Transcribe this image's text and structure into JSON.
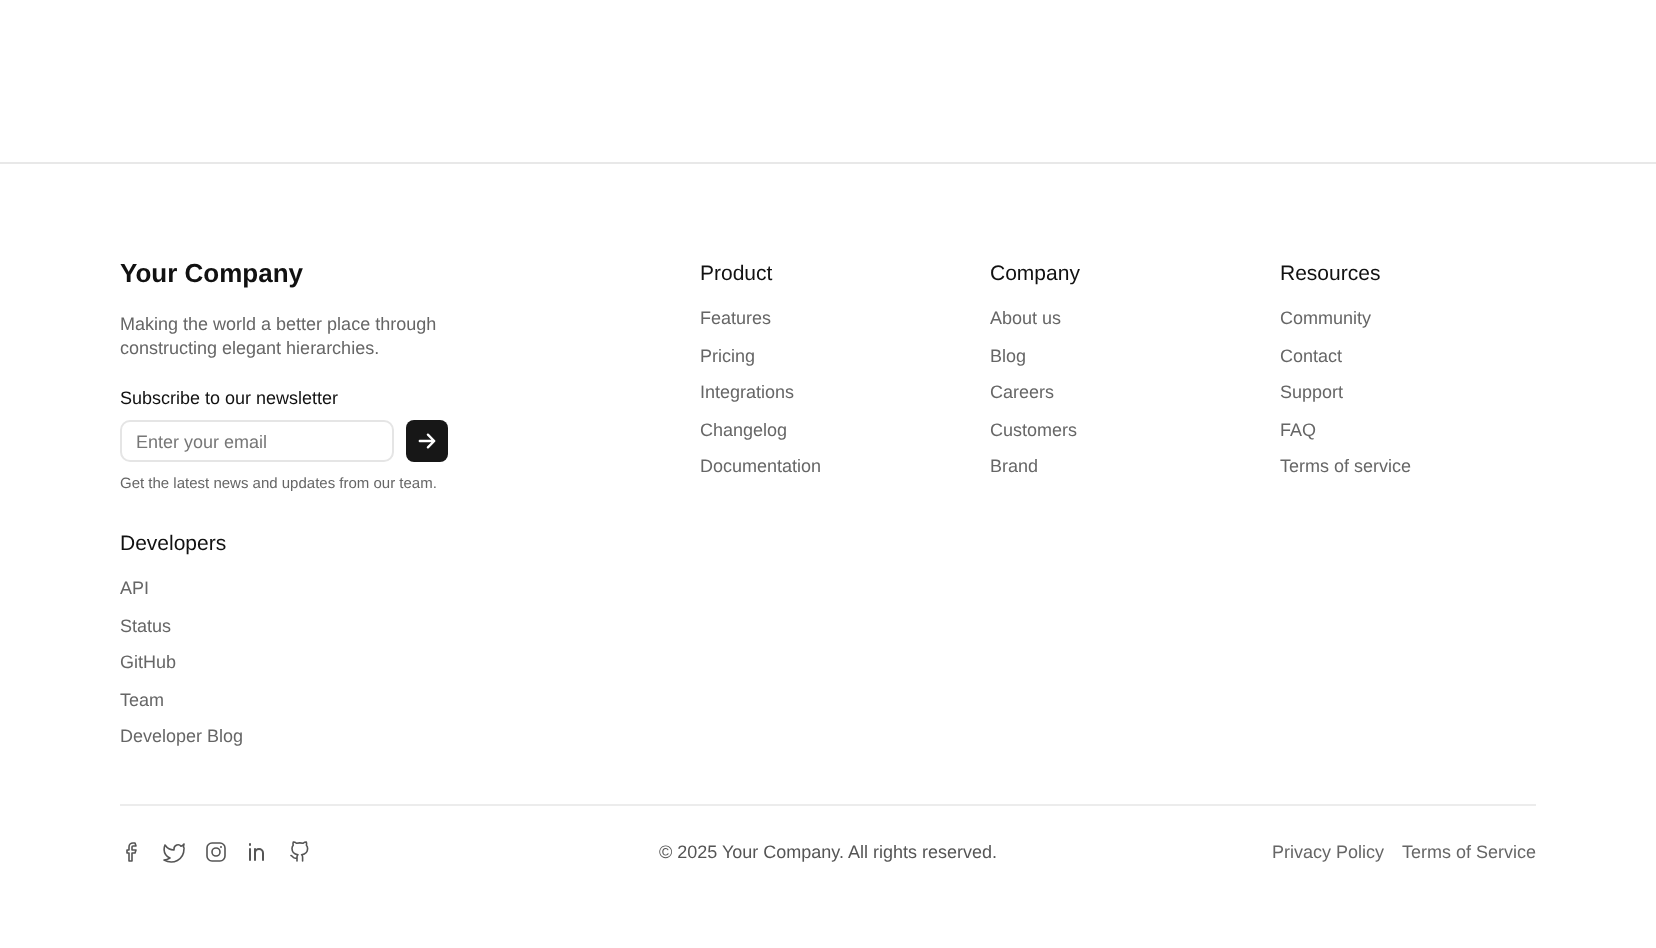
{
  "brand": {
    "name": "Your Company",
    "tagline": "Making the world a better place through constructing elegant hierarchies."
  },
  "newsletter": {
    "title": "Subscribe to our newsletter",
    "placeholder": "Enter your email",
    "note": "Get the latest news and updates from our team."
  },
  "developers": {
    "title": "Developers",
    "links": [
      "API",
      "Status",
      "GitHub",
      "Team",
      "Developer Blog"
    ]
  },
  "columns": [
    {
      "title": "Product",
      "links": [
        "Features",
        "Pricing",
        "Integrations",
        "Changelog",
        "Documentation"
      ]
    },
    {
      "title": "Company",
      "links": [
        "About us",
        "Blog",
        "Careers",
        "Customers",
        "Brand"
      ]
    },
    {
      "title": "Resources",
      "links": [
        "Community",
        "Contact",
        "Support",
        "FAQ",
        "Terms of service"
      ]
    }
  ],
  "social_links": [
    {
      "kind": "facebook"
    },
    {
      "kind": "twitter"
    },
    {
      "kind": "instagram"
    },
    {
      "kind": "linkedin"
    },
    {
      "kind": "github"
    }
  ],
  "copyright": "© 2025 Your Company. All rights reserved.",
  "legal_links": [
    "Privacy Policy",
    "Terms of Service"
  ]
}
